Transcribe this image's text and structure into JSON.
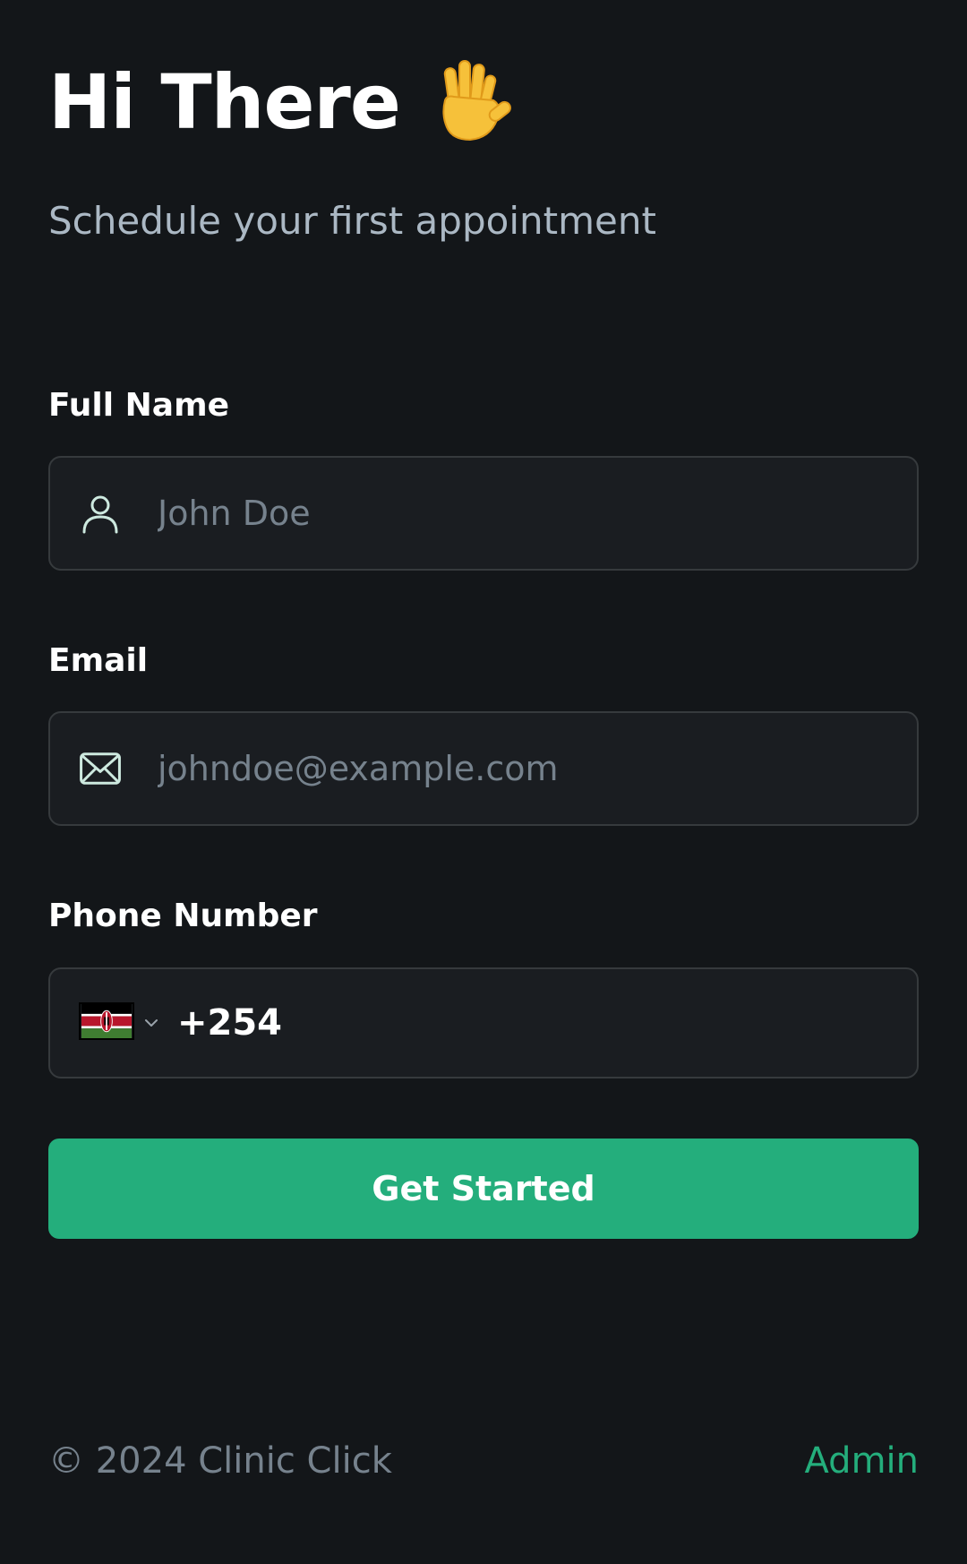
{
  "header": {
    "title": "Hi There",
    "wave_icon": "waving-hand-icon",
    "subtitle": "Schedule your first appointment"
  },
  "form": {
    "full_name": {
      "label": "Full Name",
      "placeholder": "John Doe",
      "value": "",
      "icon": "user-icon"
    },
    "email": {
      "label": "Email",
      "placeholder": "johndoe@example.com",
      "value": "",
      "icon": "mail-icon"
    },
    "phone": {
      "label": "Phone Number",
      "country_flag": "kenya-flag-icon",
      "dial_code": "+254",
      "value": ""
    },
    "submit_label": "Get Started"
  },
  "footer": {
    "copyright": "© 2024 Clinic Click",
    "admin_link": "Admin"
  },
  "colors": {
    "background": "#131619",
    "input_background": "#1a1d21",
    "input_border": "#363a3d",
    "accent": "#24ae7c",
    "subtitle": "#abb8c4",
    "placeholder": "#76828d"
  }
}
